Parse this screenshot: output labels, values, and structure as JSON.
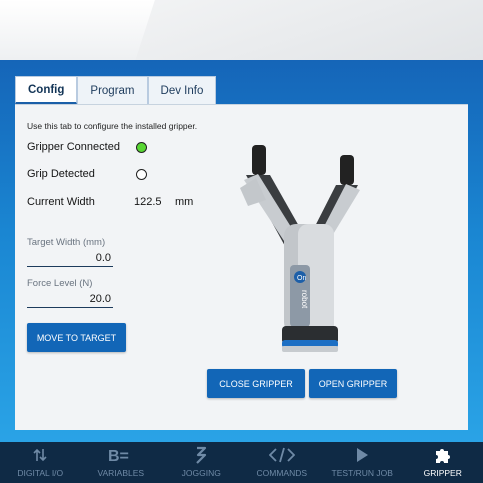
{
  "tabs": [
    {
      "label": "Config",
      "active": true
    },
    {
      "label": "Program",
      "active": false
    },
    {
      "label": "Dev Info",
      "active": false
    }
  ],
  "config": {
    "hint": "Use this tab to configure the installed gripper.",
    "gripper_connected_label": "Gripper Connected",
    "gripper_connected": true,
    "grip_detected_label": "Grip Detected",
    "grip_detected": false,
    "current_width_label": "Current Width",
    "current_width_value": "122.5",
    "current_width_unit": "mm",
    "target_width_label": "Target Width (mm)",
    "target_width_value": "0.0",
    "force_level_label": "Force Level (N)",
    "force_level_value": "20.0",
    "move_button": "MOVE TO TARGET",
    "close_button": "CLOSE GRIPPER",
    "open_button": "OPEN GRIPPER",
    "gripper_logo_text": "On robot"
  },
  "colors": {
    "accent": "#1266b7",
    "led_on": "#58d633",
    "nav_bg": "#0f2a45"
  },
  "bottom_nav": [
    {
      "label": "DIGITAL I/O",
      "icon": "digital-io-icon",
      "active": false
    },
    {
      "label": "VARIABLES",
      "icon": "variables-icon",
      "active": false
    },
    {
      "label": "JOGGING",
      "icon": "jogging-icon",
      "active": false
    },
    {
      "label": "COMMANDS",
      "icon": "commands-icon",
      "active": false
    },
    {
      "label": "TEST/RUN JOB",
      "icon": "test-run-icon",
      "active": false
    },
    {
      "label": "GRIPPER",
      "icon": "gripper-puzzle-icon",
      "active": true
    }
  ]
}
